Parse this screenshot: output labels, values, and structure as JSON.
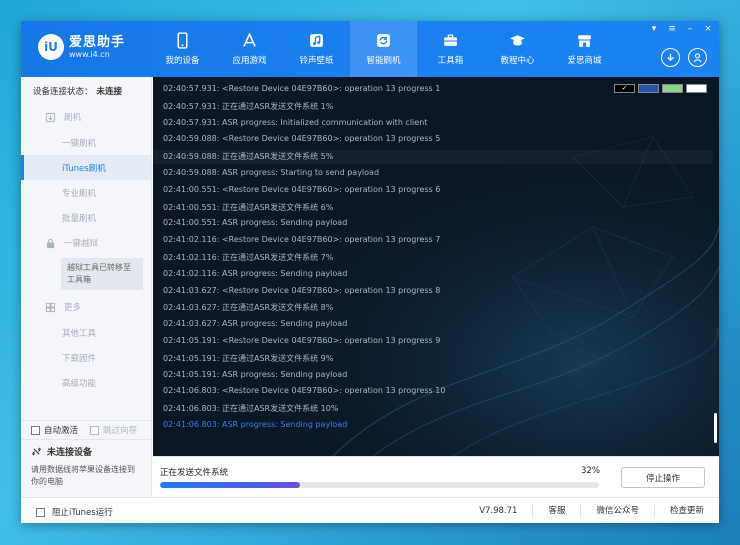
{
  "app": {
    "name": "爱思助手",
    "url": "www.i4.cn",
    "logo_text": "iU"
  },
  "window_controls": [
    "▾",
    "≡",
    "–",
    "×"
  ],
  "nav": [
    {
      "label": "我的设备",
      "icon": "phone-icon"
    },
    {
      "label": "应用游戏",
      "icon": "appstore-icon"
    },
    {
      "label": "铃声壁纸",
      "icon": "music-icon"
    },
    {
      "label": "智能刷机",
      "icon": "flash-icon",
      "active": true
    },
    {
      "label": "工具箱",
      "icon": "toolbox-icon"
    },
    {
      "label": "教程中心",
      "icon": "graduation-icon"
    },
    {
      "label": "爱思商城",
      "icon": "store-icon"
    }
  ],
  "sidebar": {
    "status_label": "设备连接状态：",
    "status_value": "未连接",
    "flash_section": "刷机",
    "flash_items": [
      "一键刷机",
      "iTunes刷机",
      "专业刷机",
      "批量刷机"
    ],
    "jailbreak_section": "一键越狱",
    "jailbreak_moved": "越狱工具已转移至工具箱",
    "more_section": "更多",
    "more_items": [
      "其他工具",
      "下载固件",
      "高级功能"
    ],
    "auto_activate": "自动激活",
    "skip_guide": "跳过向导",
    "device_title": "未连接设备",
    "device_desc": "请用数据线将苹果设备连接到你的电脑"
  },
  "log": {
    "lines": [
      "02:40:57.931: <Restore Device 04E97B60>: operation 13 progress 1",
      "02:40:57.931: 正在通过ASR发送文件系统 1%",
      "02:40:57.931: ASR progress: Initialized communication with client",
      "02:40:59.088: <Restore Device 04E97B60>: operation 13 progress 5",
      "02:40:59.088: 正在通过ASR发送文件系统 5%",
      "02:40:59.088: ASR progress: Starting to send payload",
      "02:41:00.551: <Restore Device 04E97B60>: operation 13 progress 6",
      "02:41:00.551: 正在通过ASR发送文件系统 6%",
      "02:41:00.551: ASR progress: Sending payload",
      "02:41:02.116: <Restore Device 04E97B60>: operation 13 progress 7",
      "02:41:02.116: 正在通过ASR发送文件系统 7%",
      "02:41:02.116: ASR progress: Sending payload",
      "02:41:03.627: <Restore Device 04E97B60>: operation 13 progress 8",
      "02:41:03.627: 正在通过ASR发送文件系统 8%",
      "02:41:03.627: ASR progress: Sending payload",
      "02:41:05.191: <Restore Device 04E97B60>: operation 13 progress 9",
      "02:41:05.191: 正在通过ASR发送文件系统 9%",
      "02:41:05.191: ASR progress: Sending payload",
      "02:41:06.803: <Restore Device 04E97B60>: operation 13 progress 10",
      "02:41:06.803: 正在通过ASR发送文件系统 10%",
      "02:41:06.803: ASR progress: Sending payload"
    ],
    "swatch_colors": [
      "#000000",
      "#1f56b3",
      "#8fd08f",
      "#ffffff"
    ],
    "swatch_check": "✓"
  },
  "progress": {
    "label": "正在发送文件系统",
    "percent_text": "32%",
    "fraction": 0.32,
    "stop_label": "停止操作"
  },
  "footer": {
    "block_itunes": "阻止iTunes运行",
    "version": "V7.98.71",
    "service": "客服",
    "wechat": "微信公众号",
    "update": "检查更新"
  },
  "colors": {
    "accent": "#1a7ff0",
    "log_bg": "#0b1724",
    "log_text": "#aab5c2",
    "log_last": "#3f7ee8"
  }
}
